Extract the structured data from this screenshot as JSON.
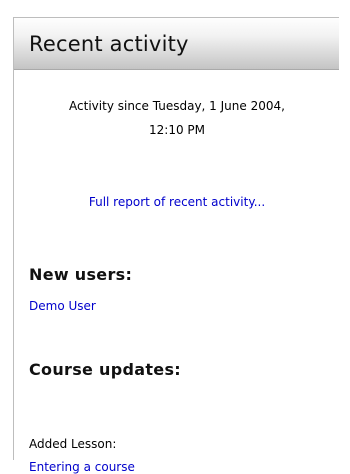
{
  "block": {
    "title": "Recent activity",
    "since_line1": "Activity since Tuesday, 1 June 2004,",
    "since_line2": "12:10 PM",
    "full_report_link": "Full report of recent activity..."
  },
  "new_users": {
    "heading": "New users:",
    "users": [
      "Demo User"
    ]
  },
  "course_updates": {
    "heading": "Course updates:",
    "items": [
      {
        "label": "Added Lesson:",
        "link": "Entering a course"
      }
    ]
  },
  "colors": {
    "link": "#0000cc",
    "header_gradient_top": "#fefefe",
    "header_gradient_bottom": "#c4c4c4"
  }
}
